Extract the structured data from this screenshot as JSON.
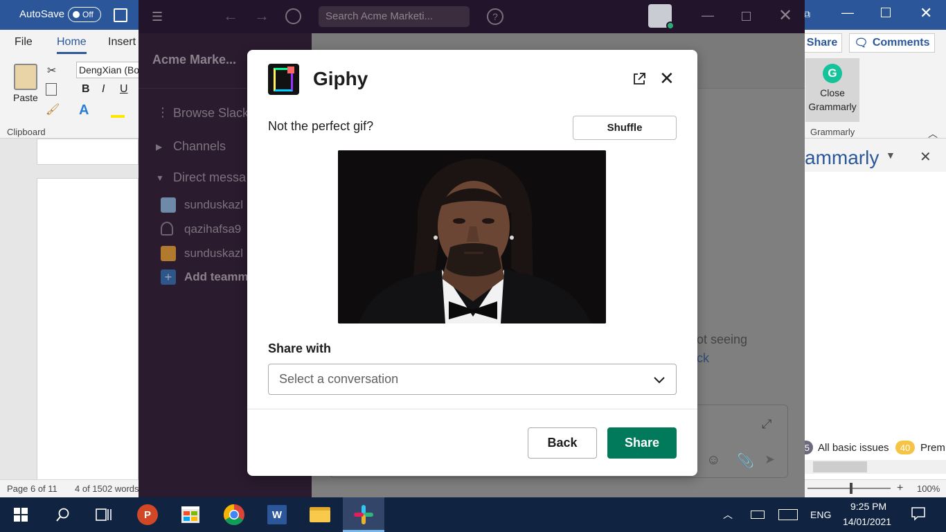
{
  "word": {
    "autosave_label": "AutoSave",
    "autosave_state": "Off",
    "tabs": [
      "File",
      "Home",
      "Insert"
    ],
    "paste_label": "Paste",
    "clipboard_label": "Clipboard",
    "font_name": "DengXian (Bo",
    "share_label": "Share",
    "comments_label": "Comments",
    "grammarly_button_line1": "Close",
    "grammarly_button_line2": "Grammarly",
    "grammarly_group_label": "Grammarly",
    "grammarly_pane_title": "ammarly",
    "issues_count": "5",
    "issues_label": "All basic issues",
    "premium_count": "40",
    "premium_label": "Prem",
    "status_page": "Page 6 of 11",
    "status_words": "4 of 1502 words",
    "zoom_level": "100%"
  },
  "slack": {
    "search_placeholder": "Search Acme Marketi...",
    "workspace_name": "Acme Marke...",
    "sidebar": {
      "browse": "Browse Slack",
      "channels": "Channels",
      "direct_messages": "Direct messa",
      "dms": [
        "sunduskazl",
        "qazihafsa9",
        "sunduskazl"
      ],
      "add_teammates": "Add teamm"
    },
    "message_fragment_1": "ot seeing",
    "message_fragment_2": "ck"
  },
  "modal": {
    "title": "Giphy",
    "prompt": "Not the perfect gif?",
    "shuffle_label": "Shuffle",
    "share_with_label": "Share with",
    "select_placeholder": "Select a conversation",
    "back_label": "Back",
    "share_label": "Share"
  },
  "taskbar": {
    "language": "ENG",
    "time": "9:25 PM",
    "date": "14/01/2021"
  },
  "colors": {
    "word_blue": "#2b579a",
    "slack_aubergine": "#2a1b2e",
    "slack_green": "#007a5a",
    "taskbar": "#102441"
  }
}
